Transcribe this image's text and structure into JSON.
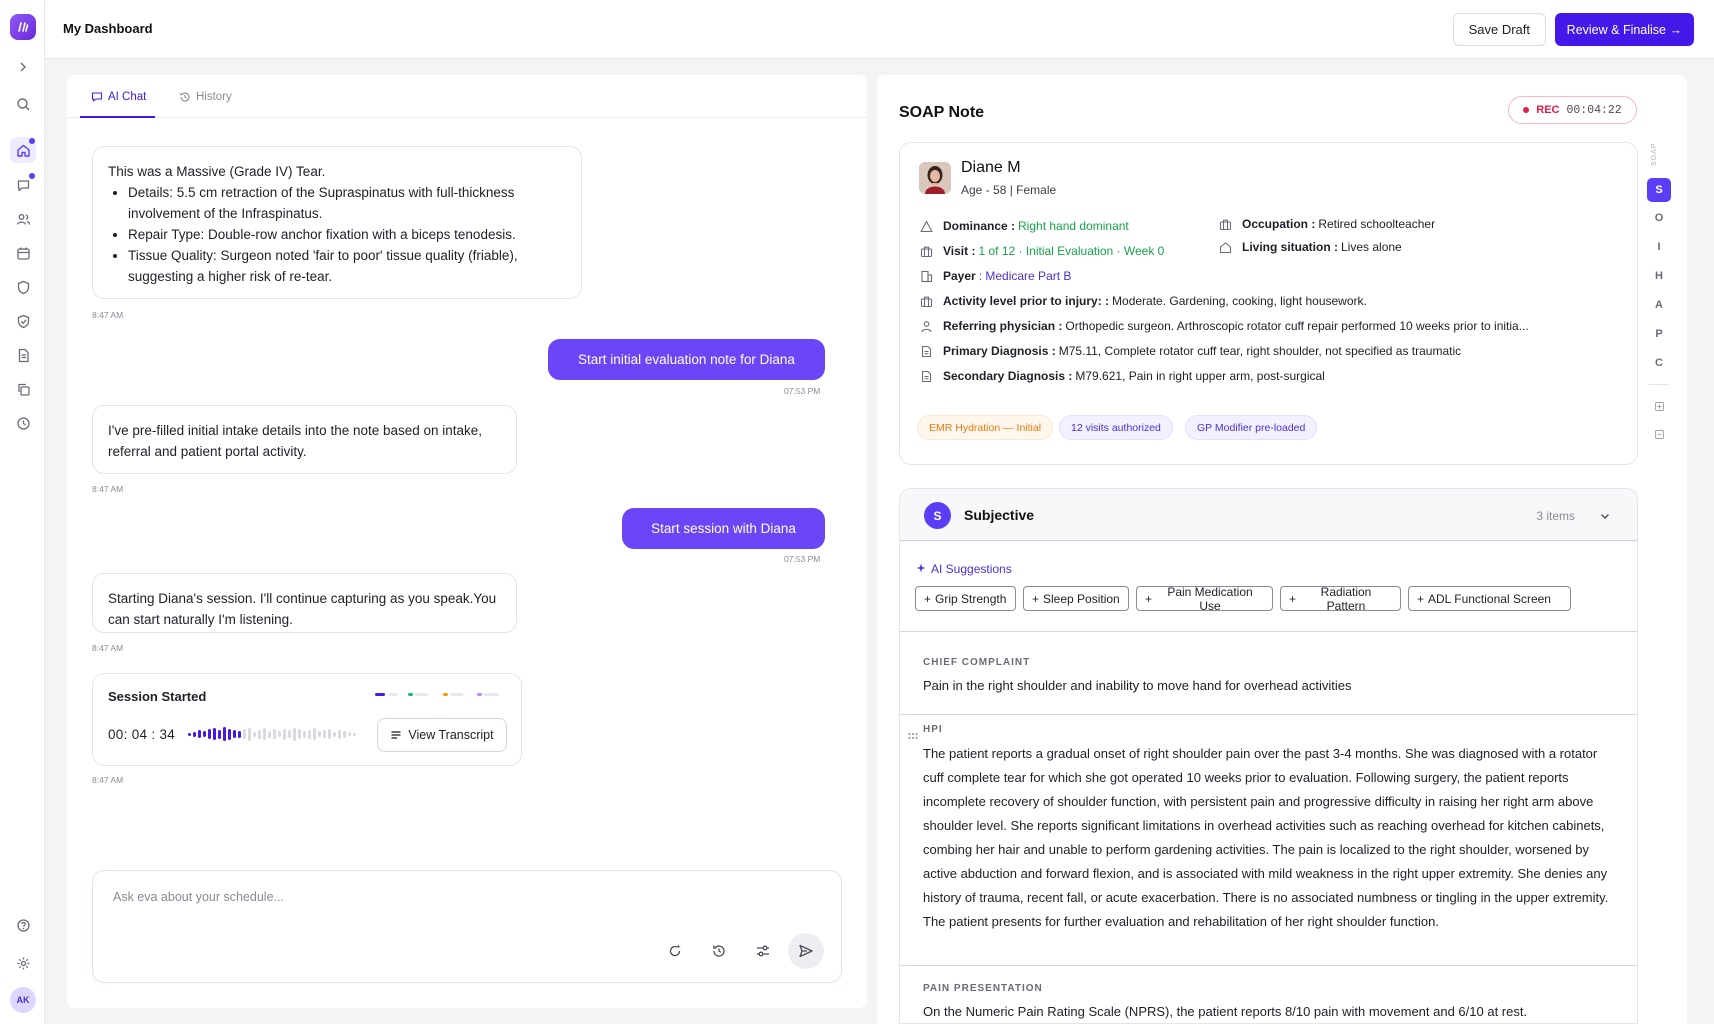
{
  "header": {
    "title": "My Dashboard",
    "save_draft": "Save Draft",
    "review_finalise": "Review & Finalise →"
  },
  "rail": {
    "avatar_initials": "AK"
  },
  "chat": {
    "tabs": [
      {
        "label": "AI Chat"
      },
      {
        "label": "History"
      }
    ],
    "messages": [
      {
        "role": "assistant",
        "intro": "This was a Massive (Grade IV) Tear.",
        "bullets": [
          "Details: 5.5 cm retraction of the Supraspinatus with full-thickness involvement of the Infraspinatus.",
          "Repair Type: Double-row anchor fixation with a biceps tenodesis.",
          "Tissue Quality: Surgeon noted 'fair to poor' tissue quality (friable), suggesting a higher risk of re-tear."
        ],
        "time": "8:47 AM"
      },
      {
        "role": "user",
        "text": "Start initial evaluation note for Diana",
        "time": "07:53 PM"
      },
      {
        "role": "assistant",
        "text": "I've pre-filled initial intake details into the note based on intake, referral and patient portal activity.",
        "time": "8:47 AM"
      },
      {
        "role": "user",
        "text": "Start session with Diana",
        "time": "07:53 PM"
      },
      {
        "role": "assistant",
        "text": "Starting Diana's session. I'll continue capturing as you speak.You can start naturally I'm listening.",
        "time": "8:47 AM"
      }
    ],
    "session": {
      "title": "Session Started",
      "timer": "00: 04 : 34",
      "view_transcript": "View Transcript",
      "time": "8:47 AM"
    },
    "composer": {
      "placeholder": "Ask eva about your schedule..."
    }
  },
  "soap": {
    "title": "SOAP Note",
    "rec": {
      "label": "REC",
      "time": "00:04:22"
    },
    "patient": {
      "name": "Diane M",
      "meta": "Age - 58 | Female",
      "fields": {
        "dominance": {
          "label": "Dominance :",
          "value": "Right hand dominant"
        },
        "occupation": {
          "label": "Occupation :",
          "value": "Retired schoolteacher"
        },
        "visit": {
          "label": "Visit :",
          "value": "1 of 12 · Initial Evaluation · Week 0"
        },
        "living": {
          "label": "Living situation :",
          "value": "Lives alone"
        },
        "payer": {
          "label": "Payer",
          "value": ": Medicare Part B"
        },
        "activity": {
          "label": "Activity level prior to injury: :",
          "value": "Moderate. Gardening, cooking, light housework."
        },
        "referring": {
          "label": "Referring physician :",
          "value": "Orthopedic surgeon. Arthroscopic rotator cuff repair performed 10 weeks prior to initia..."
        },
        "primary_dx": {
          "label": "Primary Diagnosis :",
          "value": "M75.11, Complete rotator cuff tear, right shoulder, not specified as traumatic"
        },
        "secondary_dx": {
          "label": "Secondary Diagnosis :",
          "value": "M79.621, Pain in right upper arm, post-surgical"
        }
      },
      "chips": [
        {
          "label": "EMR Hydration — Initial",
          "bg": "#fff7ed",
          "fg": "#ea7a0c",
          "border": "#fde7cf"
        },
        {
          "label": "12 visits authorized",
          "bg": "#f3f0ff",
          "fg": "#4c2fd6",
          "border": "#e6e0ff"
        },
        {
          "label": "GP Modifier pre-loaded",
          "bg": "#f3f0ff",
          "fg": "#4c2fd6",
          "border": "#e6e0ff"
        }
      ]
    },
    "subjective": {
      "badge": "S",
      "title": "Subjective",
      "count": "3 items",
      "ai_suggestions_label": "AI Suggestions",
      "suggestions": [
        "Grip Strength",
        "Sleep Position",
        "Pain Medication Use",
        "Radiation Pattern",
        "ADL Functional Screen"
      ],
      "chief_complaint_label": "CHIEF COMPLAINT",
      "chief_complaint": "Pain in the right shoulder and inability to move hand for overhead activities",
      "hpi_label": "HPI",
      "hpi": "The patient reports a gradual onset of right shoulder pain over the past 3-4 months. She was diagnosed with a rotator cuff complete tear for which she got operated 10 weeks prior to evaluation. Following surgery, the patient reports incomplete recovery of shoulder function, with persistent pain and progressive difficulty in raising her right arm above shoulder level. She reports significant limitations in overhead activities such as reaching overhead for kitchen cabinets, combing her hair and unable to perform gardening activities. The pain is localized to the right shoulder, worsened by active abduction and forward flexion, and is associated with mild weakness in the right upper extremity. She denies any history of trauma, recent fall, or acute exacerbation. There is no associated numbness or tingling in the upper extremity. The patient presents for further evaluation and rehabilitation of her right shoulder function.",
      "pain_label": "PAIN PRESENTATION",
      "pain": "On the Numeric Pain Rating Scale (NPRS), the patient reports 8/10 pain with movement and 6/10 at rest."
    },
    "index": {
      "vertical_label": "SOAP",
      "letters": [
        "S",
        "O",
        "I",
        "H",
        "A",
        "P",
        "C"
      ],
      "active": "S"
    }
  }
}
